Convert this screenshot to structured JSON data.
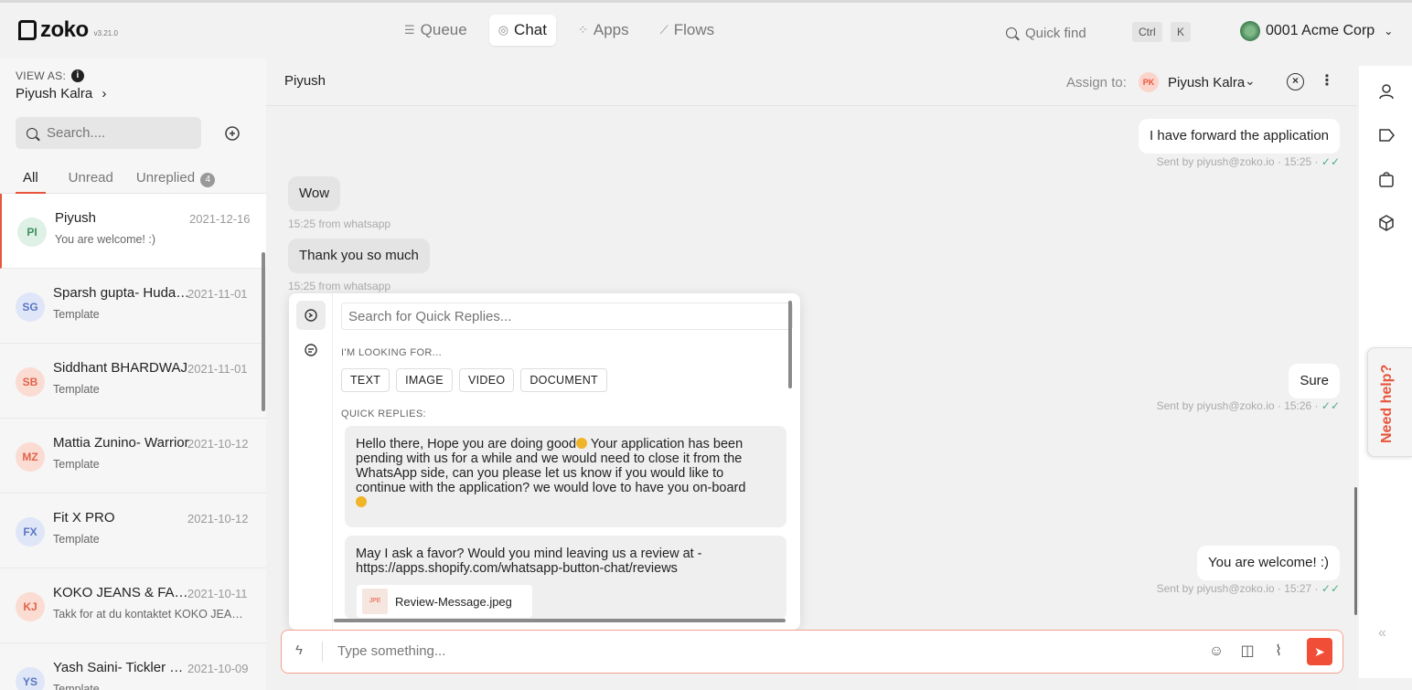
{
  "app": {
    "logo": "zoko",
    "version": "v3.21.0"
  },
  "nav": {
    "items": [
      {
        "label": "Queue",
        "icon": "list-icon"
      },
      {
        "label": "Chat",
        "icon": "chat-icon"
      },
      {
        "label": "Apps",
        "icon": "grid-icon"
      },
      {
        "label": "Flows",
        "icon": "flow-icon"
      }
    ],
    "active": "Chat"
  },
  "quickfind": {
    "placeholder": "Quick find",
    "key1": "Ctrl",
    "key2": "K"
  },
  "account": {
    "name": "0001 Acme Corp"
  },
  "sidebar": {
    "view_as_label": "VIEW AS:",
    "view_as_name": "Piyush Kalra",
    "search_placeholder": "Search....",
    "tabs": [
      {
        "label": "All"
      },
      {
        "label": "Unread"
      },
      {
        "label": "Unreplied",
        "count": "4"
      }
    ],
    "conversations": [
      {
        "initials": "PI",
        "name": "Piyush",
        "date": "2021-12-16",
        "preview": "You are welcome! :)",
        "bg": "#dff0e6",
        "fg": "#3f8f5f"
      },
      {
        "initials": "SG",
        "name": "Sparsh gupta- Hudanot",
        "date": "2021-11-01",
        "preview": "Template",
        "bg": "#dfe6f7",
        "fg": "#5a76c4"
      },
      {
        "initials": "SB",
        "name": "Siddhant BHARDWAJ",
        "date": "2021-11-01",
        "preview": "Template",
        "bg": "#fbdcd3",
        "fg": "#e0634a"
      },
      {
        "initials": "MZ",
        "name": "Mattia Zunino- Warrior",
        "date": "2021-10-12",
        "preview": "Template",
        "bg": "#fbdcd3",
        "fg": "#e0634a"
      },
      {
        "initials": "FX",
        "name": "Fit X PRO",
        "date": "2021-10-12",
        "preview": "Template",
        "bg": "#dfe6f7",
        "fg": "#5a76c4"
      },
      {
        "initials": "KJ",
        "name": "KOKO JEANS & FASHION",
        "date": "2021-10-11",
        "preview": "Takk for at du kontaktet KOKO JEANS & FASHION",
        "bg": "#fbdcd3",
        "fg": "#e0634a"
      },
      {
        "initials": "YS",
        "name": "Yash Saini- Tickler Store",
        "date": "2021-10-09",
        "preview": "Template",
        "bg": "#dfe6f7",
        "fg": "#5a76c4"
      }
    ]
  },
  "chat": {
    "title": "Piyush",
    "assign_label": "Assign to:",
    "assignee_initials": "PK",
    "assignee_name": "Piyush Kalra",
    "messages": [
      {
        "dir": "out",
        "text": "I have forward the application",
        "meta": "Sent by piyush@zoko.io · 15:25 · "
      },
      {
        "dir": "in",
        "text": "Wow",
        "meta": "15:25 from whatsapp"
      },
      {
        "dir": "in",
        "text": "Thank you so much",
        "meta": "15:25 from whatsapp"
      },
      {
        "dir": "out",
        "text": "Sure",
        "meta": "Sent by piyush@zoko.io · 15:26 · "
      },
      {
        "dir": "out",
        "text": "You are welcome! :)",
        "meta": "Sent by piyush@zoko.io · 15:27 · "
      }
    ],
    "tick_glyph": "✓✓"
  },
  "quick_replies": {
    "search_placeholder": "Search for Quick Replies...",
    "looking_for_label": "I'M LOOKING FOR...",
    "filters": [
      "TEXT",
      "IMAGE",
      "VIDEO",
      "DOCUMENT"
    ],
    "list_label": "QUICK REPLIES:",
    "items": [
      {
        "text": "Hello there, Hope you are doing good",
        "text2": " Your application has been pending with us for a while and we would need to close it from the WhatsApp side, can you please let us know if you would like to continue with the application? we would love to have you on-board"
      },
      {
        "text": "May I ask a favor? Would you mind leaving us a review at - https://apps.shopify.com/whatsapp-button-chat/reviews",
        "file_ext": "JPE",
        "file_name": "Review-Message.jpeg"
      }
    ]
  },
  "composer": {
    "placeholder": "Type something..."
  },
  "help": {
    "label": "Need help?"
  },
  "colors": {
    "accent": "#e8553d",
    "send": "#f04e36",
    "tick": "#4caf82"
  }
}
